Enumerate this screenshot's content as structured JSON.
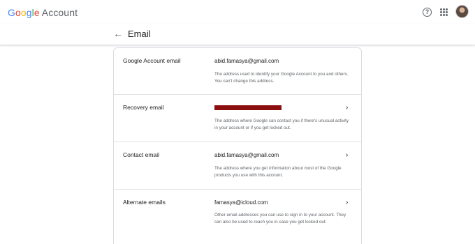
{
  "header": {
    "logo_letters": [
      "G",
      "o",
      "o",
      "g",
      "l",
      "e"
    ],
    "product": "Account",
    "icons": {
      "help": "help-circle-icon",
      "apps": "apps-grid-icon",
      "avatar": "user-avatar"
    }
  },
  "page": {
    "back_icon": "←",
    "title": "Email"
  },
  "rows": [
    {
      "label": "Google Account email",
      "value": "abid.famasya@gmail.com",
      "description": "The address used to identify your Google Account to you and others. You can't change this address.",
      "has_chevron": false
    },
    {
      "label": "Recovery email",
      "value": "",
      "redacted": true,
      "description": "The address where Google can contact you if there's unusual activity in your account or if you get locked out.",
      "has_chevron": true
    },
    {
      "label": "Contact email",
      "value": "abid.famasya@gmail.com",
      "description": "The address where you get information about most of the Google products you use with this account.",
      "has_chevron": true
    },
    {
      "label": "Alternate emails",
      "value": "famasya@icloud.com",
      "description": "Other email addresses you can use to sign in to your account. They can also be used to reach you in case you get locked out.",
      "has_chevron": true
    }
  ],
  "chevron_glyph": "›",
  "colors": {
    "google_blue": "#4285F4",
    "google_red": "#EA4335",
    "google_yellow": "#FBBC05",
    "google_green": "#34A853",
    "redaction": "#8b0f0f"
  }
}
